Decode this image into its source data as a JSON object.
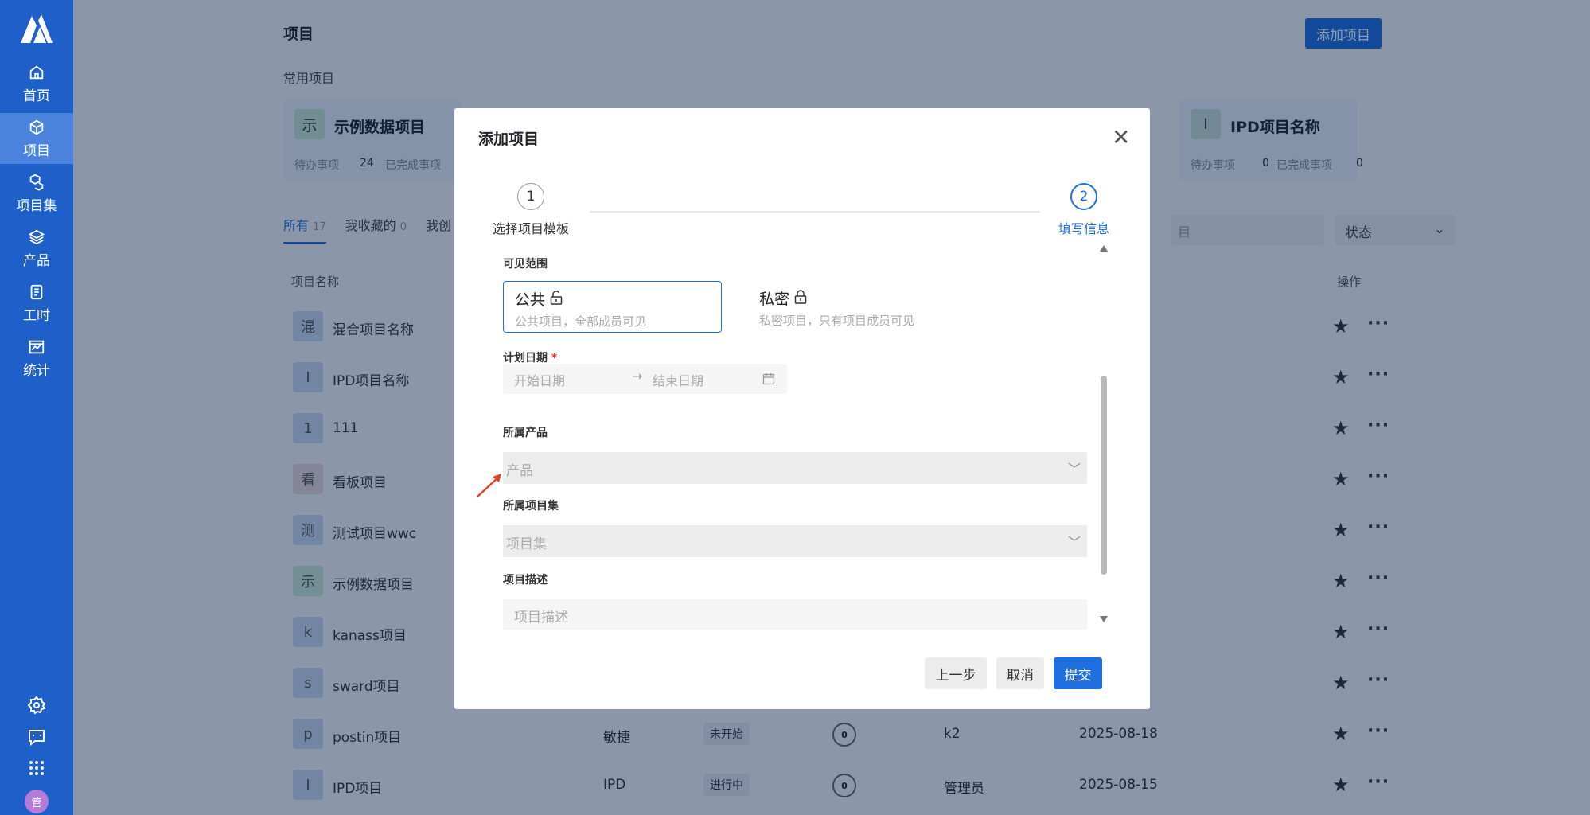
{
  "sidebar": {
    "items": [
      {
        "label": "首页",
        "icon": "home-icon"
      },
      {
        "label": "项目",
        "icon": "cube-icon"
      },
      {
        "label": "项目集",
        "icon": "cube-stack-icon"
      },
      {
        "label": "产品",
        "icon": "layers-icon"
      },
      {
        "label": "工时",
        "icon": "clipboard-icon"
      },
      {
        "label": "统计",
        "icon": "chart-icon"
      }
    ],
    "avatar": "管"
  },
  "header": {
    "title": "项目",
    "add_button": "添加项目"
  },
  "frequent": {
    "title": "常用项目",
    "cards": [
      {
        "avatar": "示",
        "name": "示例数据项目",
        "todo_label": "待办事项",
        "todo": "24",
        "done_label": "已完成事项"
      },
      {
        "avatar": "I",
        "name": "IPD项目名称",
        "todo_label": "待办事项",
        "todo": "0",
        "done_label": "已完成事项",
        "done": "0"
      }
    ]
  },
  "tabs": [
    {
      "label": "所有",
      "count": "17"
    },
    {
      "label": "我收藏的",
      "count": "0"
    },
    {
      "label": "我创"
    }
  ],
  "filters": {
    "search_placeholder": "目",
    "status_label": "状态"
  },
  "table": {
    "columns": {
      "name": "项目名称",
      "actions": "操作"
    },
    "rows": [
      {
        "avatar": "混",
        "name": "混合项目名称"
      },
      {
        "avatar": "I",
        "name": "IPD项目名称"
      },
      {
        "avatar": "1",
        "name": "111"
      },
      {
        "avatar": "看",
        "name": "看板项目"
      },
      {
        "avatar": "测",
        "name": "测试项目wwc"
      },
      {
        "avatar": "示",
        "name": "示例数据项目"
      },
      {
        "avatar": "k",
        "name": "kanass项目"
      },
      {
        "avatar": "s",
        "name": "sward项目"
      },
      {
        "avatar": "p",
        "name": "postin项目",
        "type": "敏捷",
        "status": "未开始",
        "count": "0",
        "owner": "k2",
        "date": "2025-08-18"
      },
      {
        "avatar": "I",
        "name": "IPD项目",
        "type": "IPD",
        "status": "进行中",
        "count": "0",
        "owner": "管理员",
        "date": "2025-08-15"
      }
    ]
  },
  "modal": {
    "title": "添加项目",
    "steps": [
      {
        "num": "1",
        "label": "选择项目模板"
      },
      {
        "num": "2",
        "label": "填写信息"
      }
    ],
    "visibility_label": "可见范围",
    "public": {
      "title": "公共",
      "desc": "公共项目，全部成员可见"
    },
    "private": {
      "title": "私密",
      "desc": "私密项目，只有项目成员可见"
    },
    "date_label": "计划日期",
    "date_required": "*",
    "start_placeholder": "开始日期",
    "end_placeholder": "结束日期",
    "date_arrow": "→",
    "product_label": "所属产品",
    "product_placeholder": "产品",
    "set_label": "所属项目集",
    "set_placeholder": "项目集",
    "desc_label": "项目描述",
    "desc_placeholder": "项目描述",
    "buttons": {
      "prev": "上一步",
      "cancel": "取消",
      "submit": "提交"
    }
  },
  "colors": {
    "sidebar": "#1f5fc9",
    "accent": "#1f6fe0",
    "annotation_arrow": "#e8402b"
  }
}
